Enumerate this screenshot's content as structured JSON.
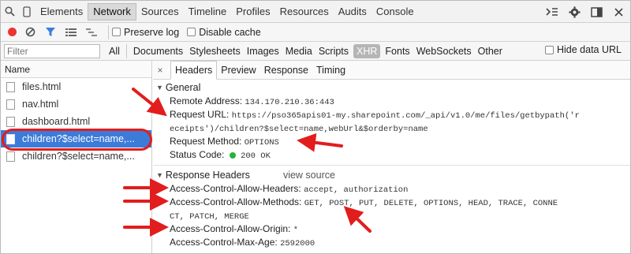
{
  "toolbar": {
    "tabs": [
      "Elements",
      "Network",
      "Sources",
      "Timeline",
      "Profiles",
      "Resources",
      "Audits",
      "Console"
    ],
    "active_tab": "Network"
  },
  "controls": {
    "preserve_log": "Preserve log",
    "disable_cache": "Disable cache"
  },
  "filter": {
    "placeholder": "Filter",
    "types": [
      "All",
      "Documents",
      "Stylesheets",
      "Images",
      "Media",
      "Scripts",
      "XHR",
      "Fonts",
      "WebSockets",
      "Other"
    ],
    "hide_data_urls": "Hide data URL"
  },
  "requests": {
    "header": "Name",
    "items": [
      "files.html",
      "nav.html",
      "dashboard.html",
      "children?$select=name,...",
      "children?$select=name,..."
    ],
    "selected_index": 3
  },
  "details": {
    "tabs": [
      "Headers",
      "Preview",
      "Response",
      "Timing"
    ],
    "close": "×",
    "general": {
      "title": "General",
      "remote_address_k": "Remote Address:",
      "remote_address_v": "134.170.210.36:443",
      "request_url_k": "Request URL:",
      "request_url_v1": "https://pso365apis01-my.sharepoint.com/_api/v1.0/me/files/getbypath('r",
      "request_url_v2": "eceipts')/children?$select=name,webUrl&$orderby=name",
      "request_method_k": "Request Method:",
      "request_method_v": "OPTIONS",
      "status_code_k": "Status Code:",
      "status_code_v": "200 OK"
    },
    "response": {
      "title": "Response Headers",
      "view_source": "view source",
      "allow_headers_k": "Access-Control-Allow-Headers:",
      "allow_headers_v": "accept, authorization",
      "allow_methods_k": "Access-Control-Allow-Methods:",
      "allow_methods_v1": "GET, POST, PUT, DELETE, OPTIONS, HEAD, TRACE, CONNE",
      "allow_methods_v2": "CT, PATCH, MERGE",
      "allow_origin_k": "Access-Control-Allow-Origin:",
      "allow_origin_v": "*",
      "max_age_k": "Access-Control-Max-Age:",
      "max_age_v": "2592000"
    }
  },
  "colors": {
    "accent": "#3d7bd9",
    "annotation": "#e21d1d",
    "record": "#e33333",
    "status_ok": "#27b33a"
  }
}
